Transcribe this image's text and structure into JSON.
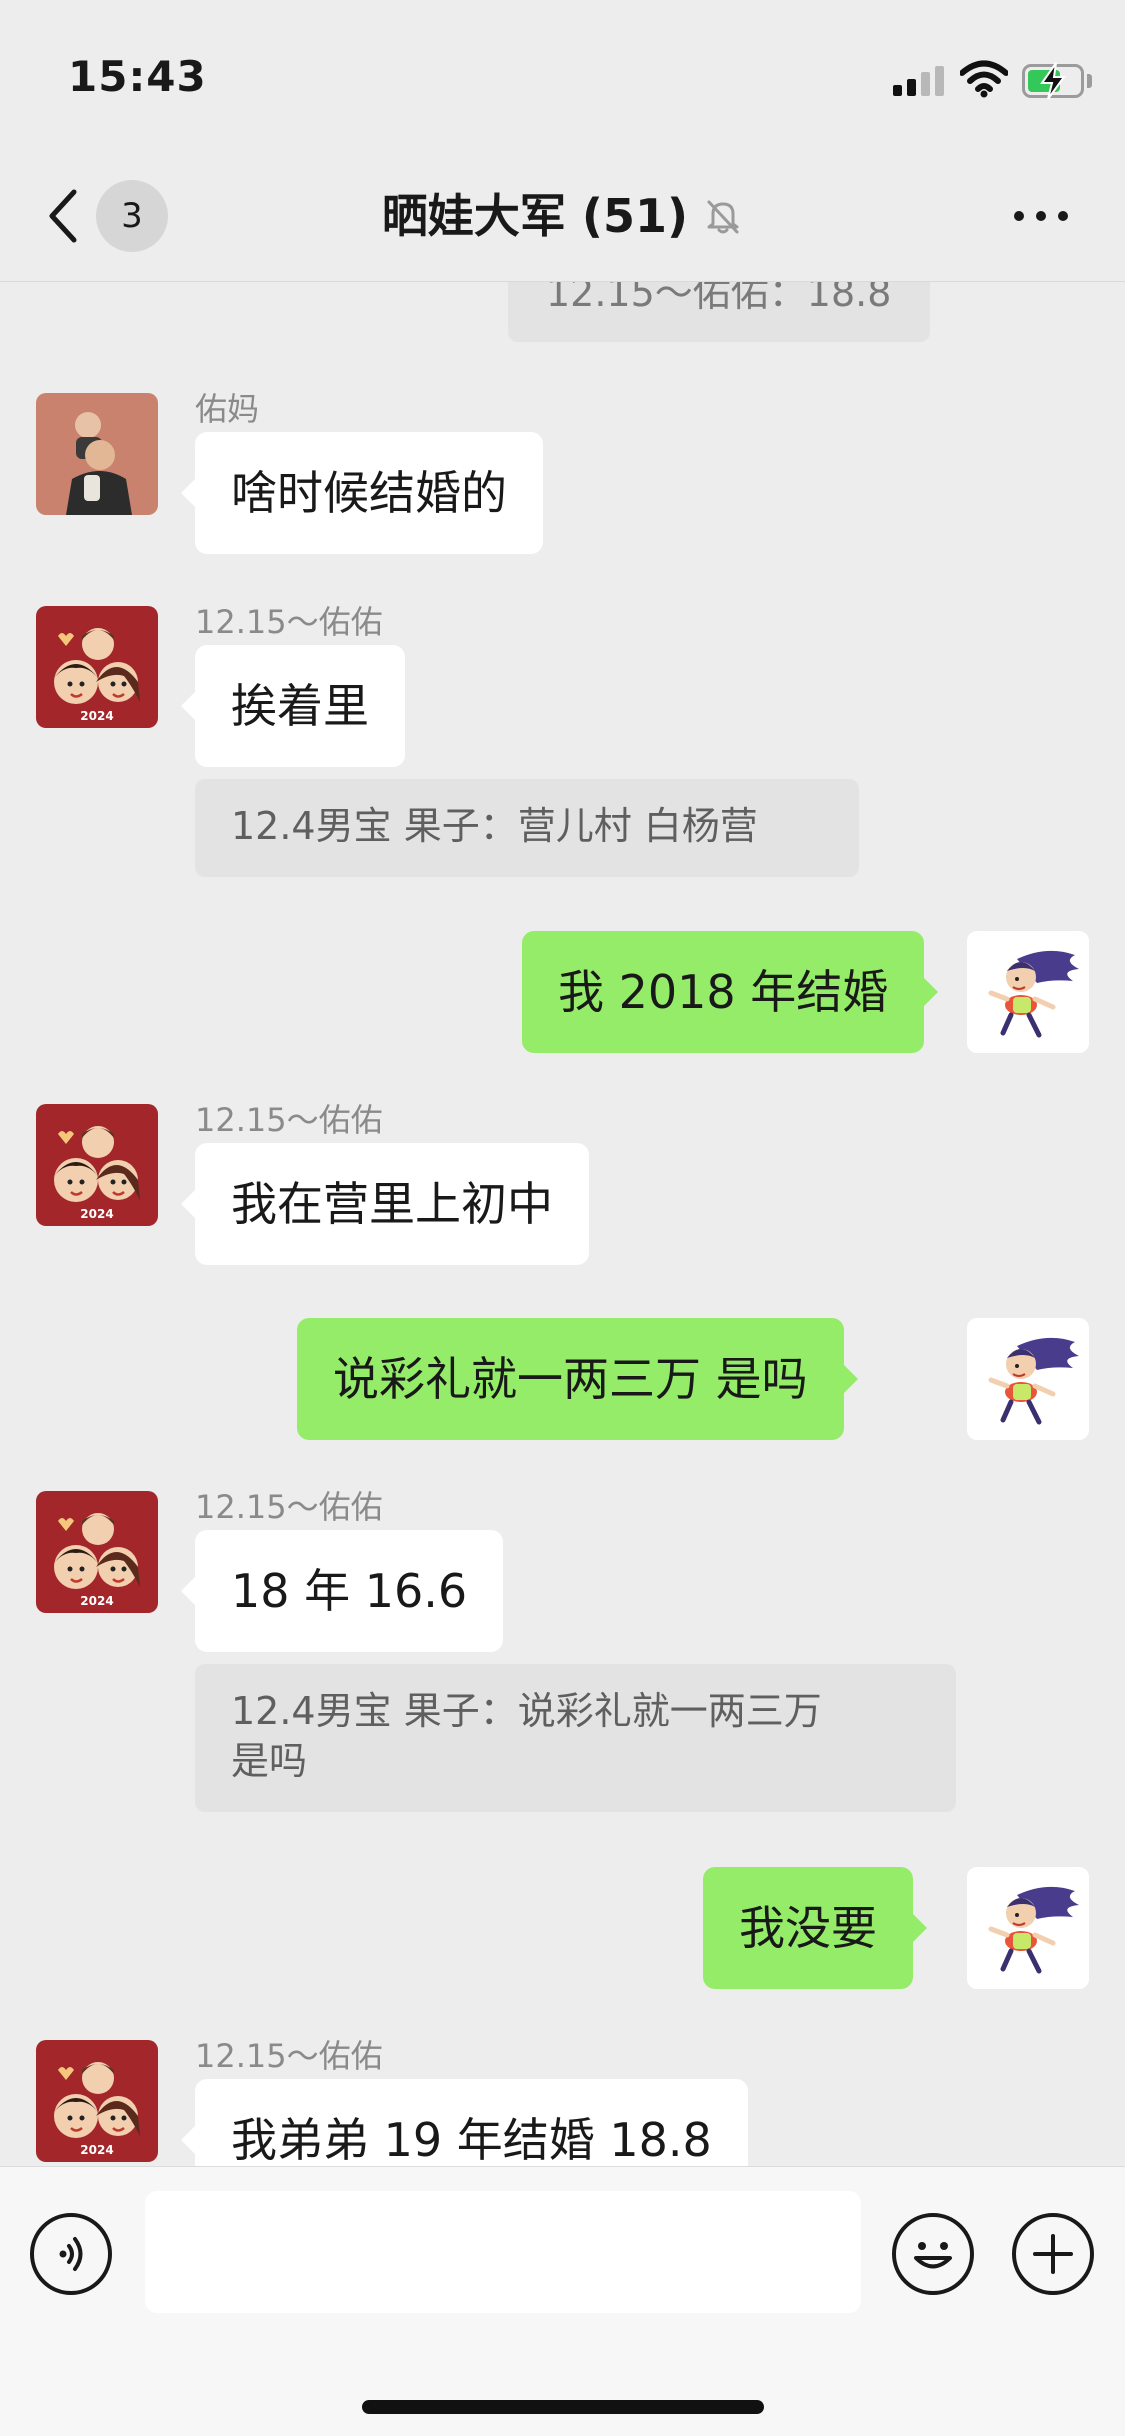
{
  "status_bar": {
    "time": "15:43"
  },
  "nav": {
    "unread_count": "3",
    "title": "晒娃大军 (51)"
  },
  "messages": {
    "top_quote": "12.15～佑佑：18.8",
    "m1": {
      "sender": "佑妈",
      "text": "啥时候结婚的"
    },
    "m2": {
      "sender": "12.15～佑佑",
      "text": "挨着里",
      "quote": "12.4男宝 果子：营儿村  白杨营"
    },
    "m3": {
      "text": "我 2018 年结婚"
    },
    "m4": {
      "sender": "12.15～佑佑",
      "text": "我在营里上初中"
    },
    "m5": {
      "text": "说彩礼就一两三万   是吗"
    },
    "m6": {
      "sender": "12.15～佑佑",
      "text": "18 年 16.6",
      "quote": "12.4男宝 果子：说彩礼就一两三万\n是吗"
    },
    "m7": {
      "text": "我没要"
    },
    "m8": {
      "sender": "12.15～佑佑",
      "text": "我弟弟 19 年结婚 18.8"
    }
  },
  "input_bar": {
    "placeholder": ""
  },
  "colors": {
    "background": "#ededed",
    "outgoing_bubble": "#95ec69",
    "incoming_bubble": "#ffffff",
    "quote_background": "#e3e3e3",
    "battery_charging": "#34c759"
  },
  "icons": {
    "back": "chevron-left-icon",
    "mute": "bell-off-icon",
    "more": "ellipsis-icon",
    "voice": "voice-icon",
    "emoji": "emoji-icon",
    "plus": "plus-icon"
  }
}
